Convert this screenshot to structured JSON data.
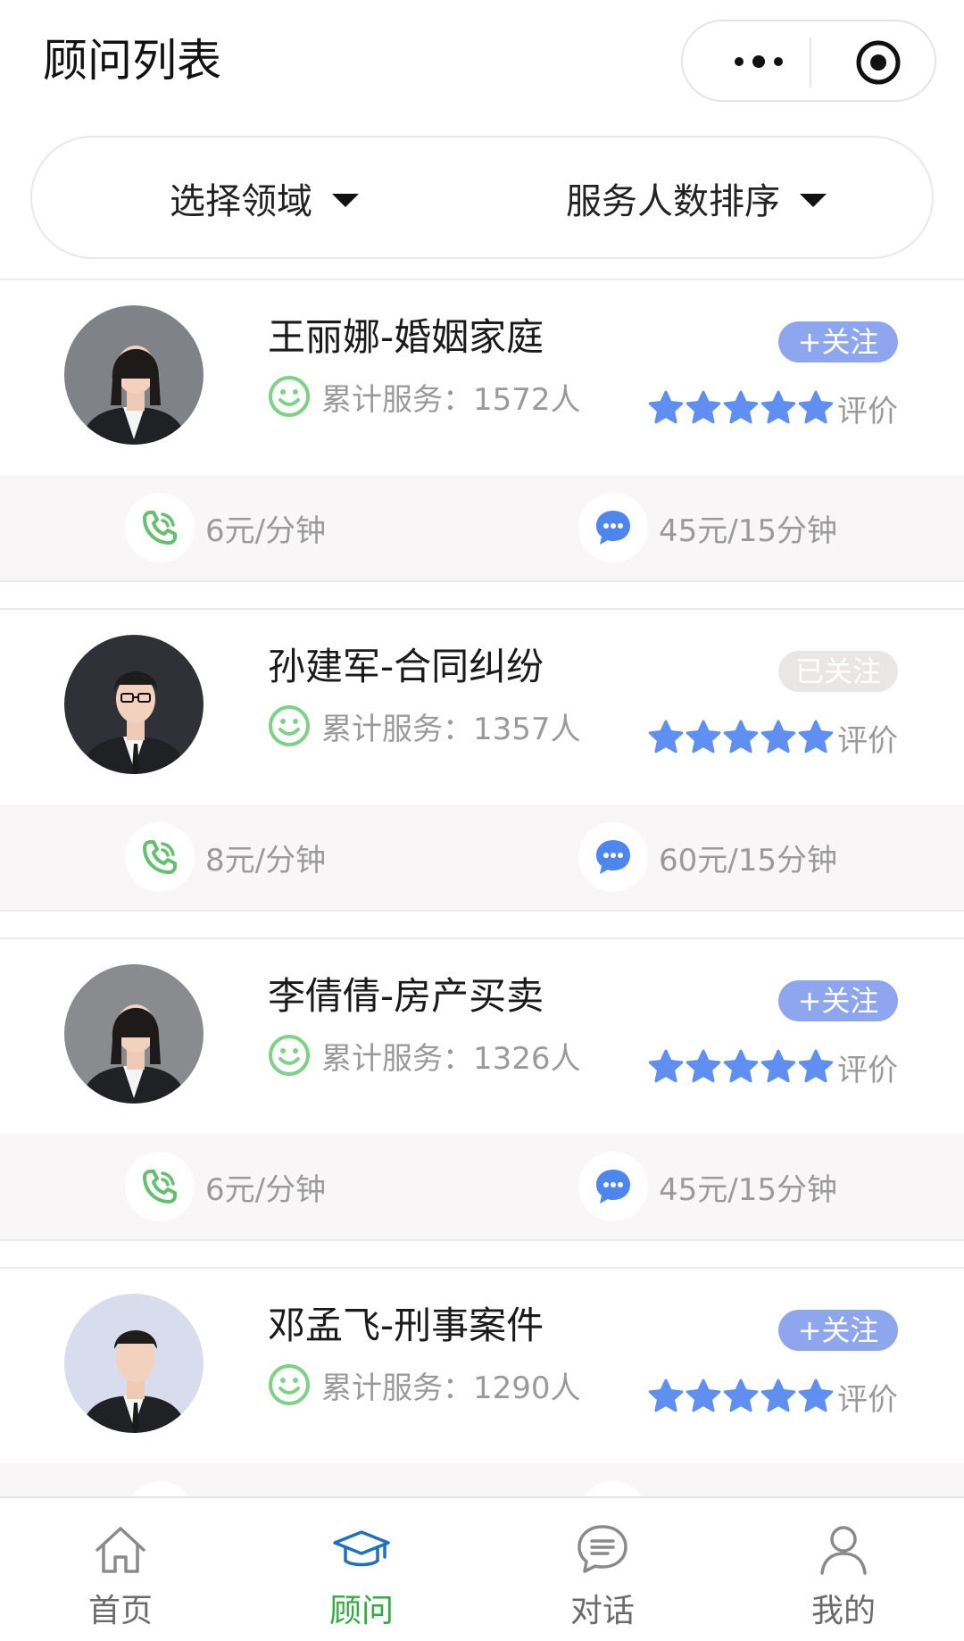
{
  "header": {
    "title": "顾问列表"
  },
  "filters": {
    "field": "选择领域",
    "sort": "服务人数排序"
  },
  "colors": {
    "accent_green": "#2fae3f",
    "star_blue": "#5f8ff0",
    "follow_blue": "#8ea6ee",
    "followed_gray": "#ebe6e6",
    "smile_green": "#7dd385",
    "chat_blue": "#4e86f0"
  },
  "advisors": [
    {
      "name": "王丽娜-婚姻家庭",
      "served": "累计服务：1572人",
      "follow": "+关注",
      "followed": false,
      "rating": 5,
      "rating_label": "评价",
      "call_price": "6元/分钟",
      "chat_price": "45元/15分钟",
      "avatar_bg": "#7f8287"
    },
    {
      "name": "孙建军-合同纠纷",
      "served": "累计服务：1357人",
      "follow": "已关注",
      "followed": true,
      "rating": 5,
      "rating_label": "评价",
      "call_price": "8元/分钟",
      "chat_price": "60元/15分钟",
      "avatar_bg": "#2f3136"
    },
    {
      "name": "李倩倩-房产买卖",
      "served": "累计服务：1326人",
      "follow": "+关注",
      "followed": false,
      "rating": 5,
      "rating_label": "评价",
      "call_price": "6元/分钟",
      "chat_price": "45元/15分钟",
      "avatar_bg": "#8a8b8e"
    },
    {
      "name": "邓孟飞-刑事案件",
      "served": "累计服务：1290人",
      "follow": "+关注",
      "followed": false,
      "rating": 5,
      "rating_label": "评价",
      "call_price": "",
      "chat_price": "",
      "avatar_bg": "#d9dcec"
    }
  ],
  "tabbar": {
    "items": [
      {
        "label": "首页",
        "icon": "home-icon"
      },
      {
        "label": "顾问",
        "icon": "graduation-cap-icon",
        "active": true
      },
      {
        "label": "对话",
        "icon": "chat-icon"
      },
      {
        "label": "我的",
        "icon": "user-icon"
      }
    ]
  }
}
